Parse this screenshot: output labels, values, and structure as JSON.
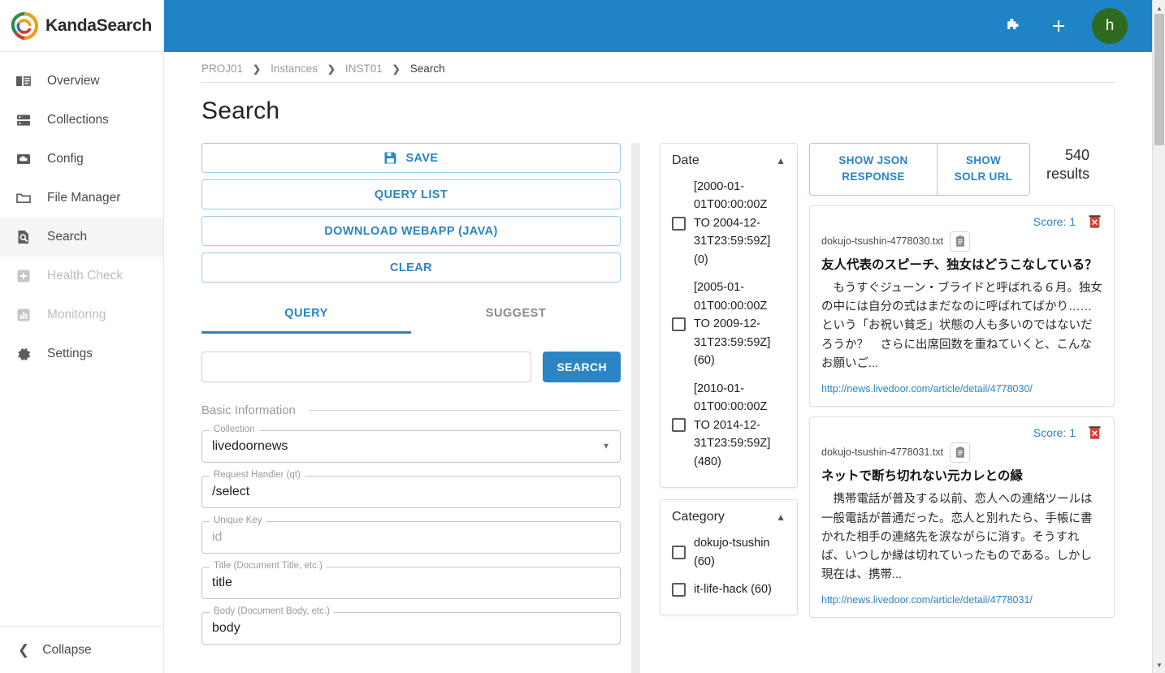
{
  "brand": {
    "name": "KandaSearch",
    "logo_icon": "kanda-swirl-logo"
  },
  "sidebar": {
    "items": [
      {
        "label": "Overview",
        "icon": "book-icon",
        "state": "enabled"
      },
      {
        "label": "Collections",
        "icon": "server-icon",
        "state": "enabled"
      },
      {
        "label": "Config",
        "icon": "config-cloud-icon",
        "state": "enabled"
      },
      {
        "label": "File Manager",
        "icon": "folder-icon",
        "state": "enabled"
      },
      {
        "label": "Search",
        "icon": "document-search-icon",
        "state": "active"
      },
      {
        "label": "Health Check",
        "icon": "health-plus-icon",
        "state": "disabled"
      },
      {
        "label": "Monitoring",
        "icon": "bar-chart-icon",
        "state": "disabled"
      },
      {
        "label": "Settings",
        "icon": "gear-icon",
        "state": "enabled"
      }
    ],
    "collapse_label": "Collapse",
    "collapse_icon": "chevron-left-icon"
  },
  "topbar": {
    "extension_icon": "puzzle-icon",
    "add_icon": "plus-icon",
    "avatar_initial": "h",
    "bg_color": "#1f83c6",
    "avatar_color": "#2f6b1e"
  },
  "breadcrumb": {
    "items": [
      "PROJ01",
      "Instances",
      "INST01",
      "Search"
    ],
    "separator": "❯"
  },
  "page": {
    "title": "Search"
  },
  "query_panel": {
    "buttons": [
      {
        "label": "SAVE",
        "icon": "save-disk-icon"
      },
      {
        "label": "QUERY LIST",
        "icon": ""
      },
      {
        "label": "DOWNLOAD WEBAPP (JAVA)",
        "icon": ""
      },
      {
        "label": "CLEAR",
        "icon": ""
      }
    ],
    "tabs": [
      {
        "label": "QUERY",
        "active": true
      },
      {
        "label": "SUGGEST",
        "active": false
      }
    ],
    "search_input_value": "",
    "search_input_placeholder": "",
    "search_button_label": "SEARCH",
    "section_title": "Basic Information",
    "fields": [
      {
        "legend": "Collection",
        "value": "livedoornews",
        "is_placeholder": false,
        "type": "select"
      },
      {
        "legend": "Request Handler (qt)",
        "value": "/select",
        "is_placeholder": false,
        "type": "text"
      },
      {
        "legend": "Unique Key",
        "value": "id",
        "is_placeholder": true,
        "type": "text"
      },
      {
        "legend": "Title (Document Title, etc.)",
        "value": "title",
        "is_placeholder": false,
        "type": "text"
      },
      {
        "legend": "Body (Document Body, etc.)",
        "value": "body",
        "is_placeholder": false,
        "type": "text"
      }
    ]
  },
  "facets": [
    {
      "title": "Date",
      "chevron": "chevron-up-icon",
      "rows": [
        {
          "label": "[2000-01-01T00:00:00Z TO 2004-12-31T23:59:59Z] (0)",
          "checked": false
        },
        {
          "label": "[2005-01-01T00:00:00Z TO 2009-12-31T23:59:59Z] (60)",
          "checked": false
        },
        {
          "label": "[2010-01-01T00:00:00Z TO 2014-12-31T23:59:59Z] (480)",
          "checked": false
        }
      ]
    },
    {
      "title": "Category",
      "chevron": "chevron-up-icon",
      "rows": [
        {
          "label": "dokujo-tsushin (60)",
          "checked": false
        },
        {
          "label": "it-life-hack (60)",
          "checked": false
        }
      ]
    }
  ],
  "results": {
    "show_json_label": "SHOW JSON RESPONSE",
    "show_solr_label": "SHOW SOLR URL",
    "count_number": "540",
    "count_word": "results",
    "cards": [
      {
        "score_label": "Score: 1",
        "filename": "dokujo-tsushin-4778030.txt",
        "copy_icon": "clipboard-icon",
        "delete_icon": "trash-icon",
        "title": "友人代表のスピーチ、独女はどうこなしている？",
        "body": "　もうすぐジューン・ブライドと呼ばれる６月。独女の中には自分の式はまだなのに呼ばれてばかり……という「お祝い貧乏」状態の人も多いのではないだろうか？　さらに出席回数を重ねていくと、こんなお願いご...",
        "url": "http://news.livedoor.com/article/detail/4778030/"
      },
      {
        "score_label": "Score: 1",
        "filename": "dokujo-tsushin-4778031.txt",
        "copy_icon": "clipboard-icon",
        "delete_icon": "trash-icon",
        "title": "ネットで断ち切れない元カレとの縁",
        "body": "　携帯電話が普及する以前、恋人への連絡ツールは一般電話が普通だった。恋人と別れたら、手帳に書かれた相手の連絡先を涙ながらに消す。そうすれば、いつしか縁は切れていったものである。しかし現在は、携帯...",
        "url": "http://news.livedoor.com/article/detail/4778031/"
      }
    ]
  },
  "scrollbar": {
    "up_icon": "triangle-up-icon",
    "down_icon": "triangle-down-icon"
  }
}
